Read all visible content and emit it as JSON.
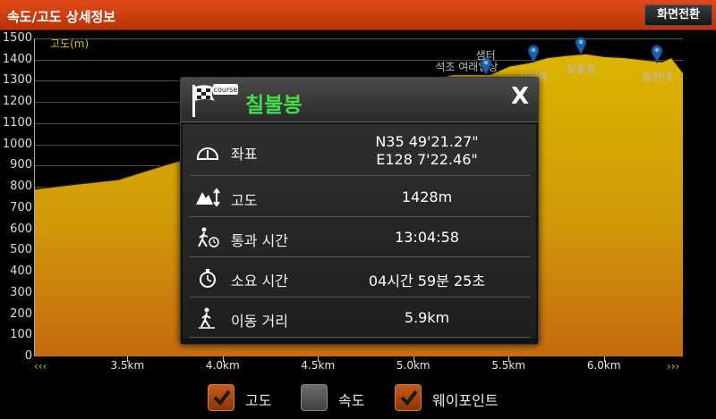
{
  "header": {
    "title": "속도/고도 상세정보",
    "switch_button": "화면전환"
  },
  "chart_data": {
    "type": "area",
    "ylabel": "고도(m)",
    "ylim": [
      0,
      1500
    ],
    "yticks": [
      0,
      100,
      200,
      300,
      400,
      500,
      600,
      700,
      800,
      900,
      1000,
      1100,
      1200,
      1300,
      1400,
      1500
    ],
    "xticks": [
      "3.5km",
      "4.0km",
      "4.5km",
      "5.0km",
      "5.5km",
      "6.0km"
    ],
    "x": [
      3.01,
      3.2,
      3.45,
      3.7,
      3.9,
      4.0,
      4.2,
      4.5,
      4.7,
      4.9,
      5.05,
      5.2,
      5.4,
      5.5,
      5.6,
      5.7,
      5.8,
      5.9,
      6.0,
      6.1,
      6.2,
      6.3,
      6.35,
      6.41
    ],
    "elevation": [
      790,
      810,
      835,
      905,
      955,
      1020,
      1070,
      1100,
      1180,
      1230,
      1290,
      1330,
      1330,
      1370,
      1385,
      1410,
      1420,
      1428,
      1415,
      1410,
      1400,
      1390,
      1410,
      1340
    ],
    "series_color": "#e7a900",
    "waypoints": [
      {
        "name": "석조 여래입상",
        "x": 5.28,
        "marker": false
      },
      {
        "name": "샘터",
        "x": 5.38,
        "marker": true
      },
      {
        "name": "서인봉",
        "x": 5.63,
        "marker": true
      },
      {
        "name": "칠불봉",
        "x": 5.88,
        "marker": true
      },
      {
        "name": "불천대",
        "x": 6.28,
        "marker": true
      }
    ]
  },
  "popup": {
    "flag_text": "course",
    "title": "칠불봉",
    "close_label": "X",
    "rows": [
      {
        "icon": "coordinate-icon",
        "label": "좌표",
        "value": "N35 49'21.27\"",
        "value2": "E128 7'22.46\""
      },
      {
        "icon": "altitude-icon",
        "label": "고도",
        "value": "1428m"
      },
      {
        "icon": "pass-time-icon",
        "label": "통과 시간",
        "value": "13:04:58"
      },
      {
        "icon": "stopwatch-icon",
        "label": "소요 시간",
        "value": "04시간 59분 25초"
      },
      {
        "icon": "walking-icon",
        "label": "이동 거리",
        "value": "5.9km"
      }
    ]
  },
  "legend": [
    {
      "label": "고도",
      "checked": true
    },
    {
      "label": "속도",
      "checked": false
    },
    {
      "label": "웨이포인트",
      "checked": true
    }
  ],
  "scroll": {
    "left": "‹‹‹",
    "right": "›››"
  }
}
